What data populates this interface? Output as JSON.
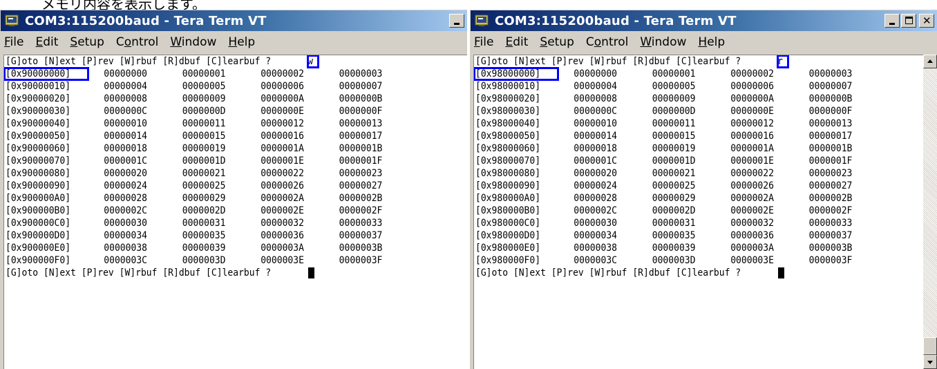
{
  "caption": "メモリ内容を表示します。",
  "windows": [
    {
      "title": "COM3:115200baud - Tera Term VT",
      "menu": [
        "File",
        "Edit",
        "Setup",
        "Control",
        "Window",
        "Help"
      ],
      "prompt": "[G]oto [N]ext [P]rev [W]rbuf [R]dbuf [C]learbuf ? ",
      "typed_key": "w",
      "rows": [
        [
          "[0x90000000]",
          "00000000",
          "00000001",
          "00000002",
          "00000003"
        ],
        [
          "[0x90000010]",
          "00000004",
          "00000005",
          "00000006",
          "00000007"
        ],
        [
          "[0x90000020]",
          "00000008",
          "00000009",
          "0000000A",
          "0000000B"
        ],
        [
          "[0x90000030]",
          "0000000C",
          "0000000D",
          "0000000E",
          "0000000F"
        ],
        [
          "[0x90000040]",
          "00000010",
          "00000011",
          "00000012",
          "00000013"
        ],
        [
          "[0x90000050]",
          "00000014",
          "00000015",
          "00000016",
          "00000017"
        ],
        [
          "[0x90000060]",
          "00000018",
          "00000019",
          "0000001A",
          "0000001B"
        ],
        [
          "[0x90000070]",
          "0000001C",
          "0000001D",
          "0000001E",
          "0000001F"
        ],
        [
          "[0x90000080]",
          "00000020",
          "00000021",
          "00000022",
          "00000023"
        ],
        [
          "[0x90000090]",
          "00000024",
          "00000025",
          "00000026",
          "00000027"
        ],
        [
          "[0x900000A0]",
          "00000028",
          "00000029",
          "0000002A",
          "0000002B"
        ],
        [
          "[0x900000B0]",
          "0000002C",
          "0000002D",
          "0000002E",
          "0000002F"
        ],
        [
          "[0x900000C0]",
          "00000030",
          "00000031",
          "00000032",
          "00000033"
        ],
        [
          "[0x900000D0]",
          "00000034",
          "00000035",
          "00000036",
          "00000037"
        ],
        [
          "[0x900000E0]",
          "00000038",
          "00000039",
          "0000003A",
          "0000003B"
        ],
        [
          "[0x900000F0]",
          "0000003C",
          "0000003D",
          "0000003E",
          "0000003F"
        ]
      ],
      "final_prompt": "[G]oto [N]ext [P]rev [W]rbuf [R]dbuf [C]learbuf ? "
    },
    {
      "title": "COM3:115200baud - Tera Term VT",
      "menu": [
        "File",
        "Edit",
        "Setup",
        "Control",
        "Window",
        "Help"
      ],
      "prompt": "[G]oto [N]ext [P]rev [W]rbuf [R]dbuf [C]learbuf ? ",
      "typed_key": "r",
      "rows": [
        [
          "[0x98000000]",
          "00000000",
          "00000001",
          "00000002",
          "00000003"
        ],
        [
          "[0x98000010]",
          "00000004",
          "00000005",
          "00000006",
          "00000007"
        ],
        [
          "[0x98000020]",
          "00000008",
          "00000009",
          "0000000A",
          "0000000B"
        ],
        [
          "[0x98000030]",
          "0000000C",
          "0000000D",
          "0000000E",
          "0000000F"
        ],
        [
          "[0x98000040]",
          "00000010",
          "00000011",
          "00000012",
          "00000013"
        ],
        [
          "[0x98000050]",
          "00000014",
          "00000015",
          "00000016",
          "00000017"
        ],
        [
          "[0x98000060]",
          "00000018",
          "00000019",
          "0000001A",
          "0000001B"
        ],
        [
          "[0x98000070]",
          "0000001C",
          "0000001D",
          "0000001E",
          "0000001F"
        ],
        [
          "[0x98000080]",
          "00000020",
          "00000021",
          "00000022",
          "00000023"
        ],
        [
          "[0x98000090]",
          "00000024",
          "00000025",
          "00000026",
          "00000027"
        ],
        [
          "[0x980000A0]",
          "00000028",
          "00000029",
          "0000002A",
          "0000002B"
        ],
        [
          "[0x980000B0]",
          "0000002C",
          "0000002D",
          "0000002E",
          "0000002F"
        ],
        [
          "[0x980000C0]",
          "00000030",
          "00000031",
          "00000032",
          "00000033"
        ],
        [
          "[0x980000D0]",
          "00000034",
          "00000035",
          "00000036",
          "00000037"
        ],
        [
          "[0x980000E0]",
          "00000038",
          "00000039",
          "0000003A",
          "0000003B"
        ],
        [
          "[0x980000F0]",
          "0000003C",
          "0000003D",
          "0000003E",
          "0000003F"
        ]
      ],
      "final_prompt": "[G]oto [N]ext [P]rev [W]rbuf [R]dbuf [C]learbuf ? "
    }
  ],
  "colors": {
    "highlight": "#0000ff",
    "titlebar_start": "#0a246a",
    "titlebar_end": "#a6caf0"
  },
  "icons": {
    "app": "tera-term-icon",
    "minimize": "minimize-icon",
    "maximize": "maximize-icon",
    "close": "close-icon",
    "scroll_up": "scroll-up-icon",
    "scroll_down": "scroll-down-icon"
  }
}
